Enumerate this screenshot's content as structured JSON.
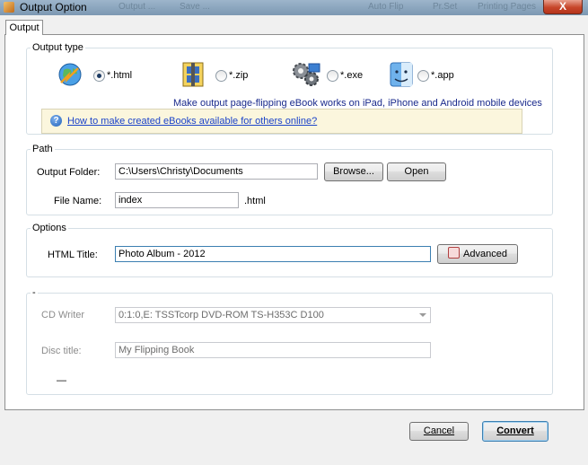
{
  "window": {
    "title": "Output Option",
    "close_glyph": "X"
  },
  "background_titlebar_text": [
    "Output ...",
    "Save ...",
    "Auto Flip",
    "Pr.Set",
    "Printing Pages"
  ],
  "tabs": [
    {
      "label": "Output"
    }
  ],
  "output_type": {
    "legend": "Output type",
    "options": [
      {
        "icon": "globe-html-icon",
        "label": "*.html",
        "selected": true
      },
      {
        "icon": "zip-archive-icon",
        "label": "*.zip",
        "selected": false
      },
      {
        "icon": "gears-exe-icon",
        "label": "*.exe",
        "selected": false
      },
      {
        "icon": "mac-finder-icon",
        "label": "*.app",
        "selected": false
      }
    ],
    "note": "Make output page-flipping eBook works on iPad, iPhone and Android mobile devices",
    "help_link": "How to make created eBooks available for others online?"
  },
  "path": {
    "legend": "Path",
    "output_folder_label": "Output Folder:",
    "output_folder_value": "C:\\Users\\Christy\\Documents",
    "browse_label": "Browse...",
    "open_label": "Open",
    "file_name_label": "File Name:",
    "file_name_value": "index",
    "file_ext": ".html"
  },
  "options": {
    "legend": "Options",
    "html_title_label": "HTML Title:",
    "html_title_value": "Photo Album - 2012",
    "advanced_label": "Advanced"
  },
  "burn": {
    "legend_top": "-",
    "legend_bottom": "—",
    "cd_writer_label": "CD Writer",
    "cd_writer_value": "0:1:0,E: TSSTcorp DVD-ROM TS-H353C D100",
    "disc_title_label": "Disc title:",
    "disc_title_value": "My Flipping Book"
  },
  "footer": {
    "cancel_label": "Cancel",
    "convert_label": "Convert"
  },
  "colors": {
    "accent": "#3c7fb1",
    "link": "#1b43c9",
    "info_bg": "#fbf6dd",
    "close": "#c7462a"
  }
}
